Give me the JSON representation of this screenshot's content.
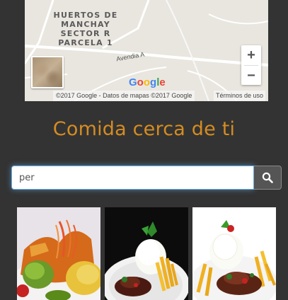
{
  "map": {
    "place_label_lines": [
      "HUERTOS DE",
      "MANCHAY",
      "SECTOR R",
      "PARCELA 1"
    ],
    "road_label": "Avendia A",
    "zoom_in": "+",
    "zoom_out": "−",
    "attribution": "©2017 Google - Datos de mapas ©2017 Google",
    "terms": "Términos de uso",
    "logo_letters": [
      "G",
      "o",
      "o",
      "g",
      "l",
      "e"
    ],
    "logo_colors": [
      "#4285F4",
      "#EA4335",
      "#FBBC05",
      "#4285F4",
      "#34A853",
      "#EA4335"
    ]
  },
  "heading": "Comida cerca de ti",
  "search": {
    "value": "per",
    "icon": "search-icon"
  },
  "colors": {
    "background": "#333333",
    "heading": "#d58c22",
    "search_button": "#555555"
  },
  "cards": [
    {
      "name": "food-card-1",
      "alt": "salad-plate-photo"
    },
    {
      "name": "food-card-2",
      "alt": "lomo-saltado-photo-dark"
    },
    {
      "name": "food-card-3",
      "alt": "lomo-saltado-photo-light"
    }
  ]
}
